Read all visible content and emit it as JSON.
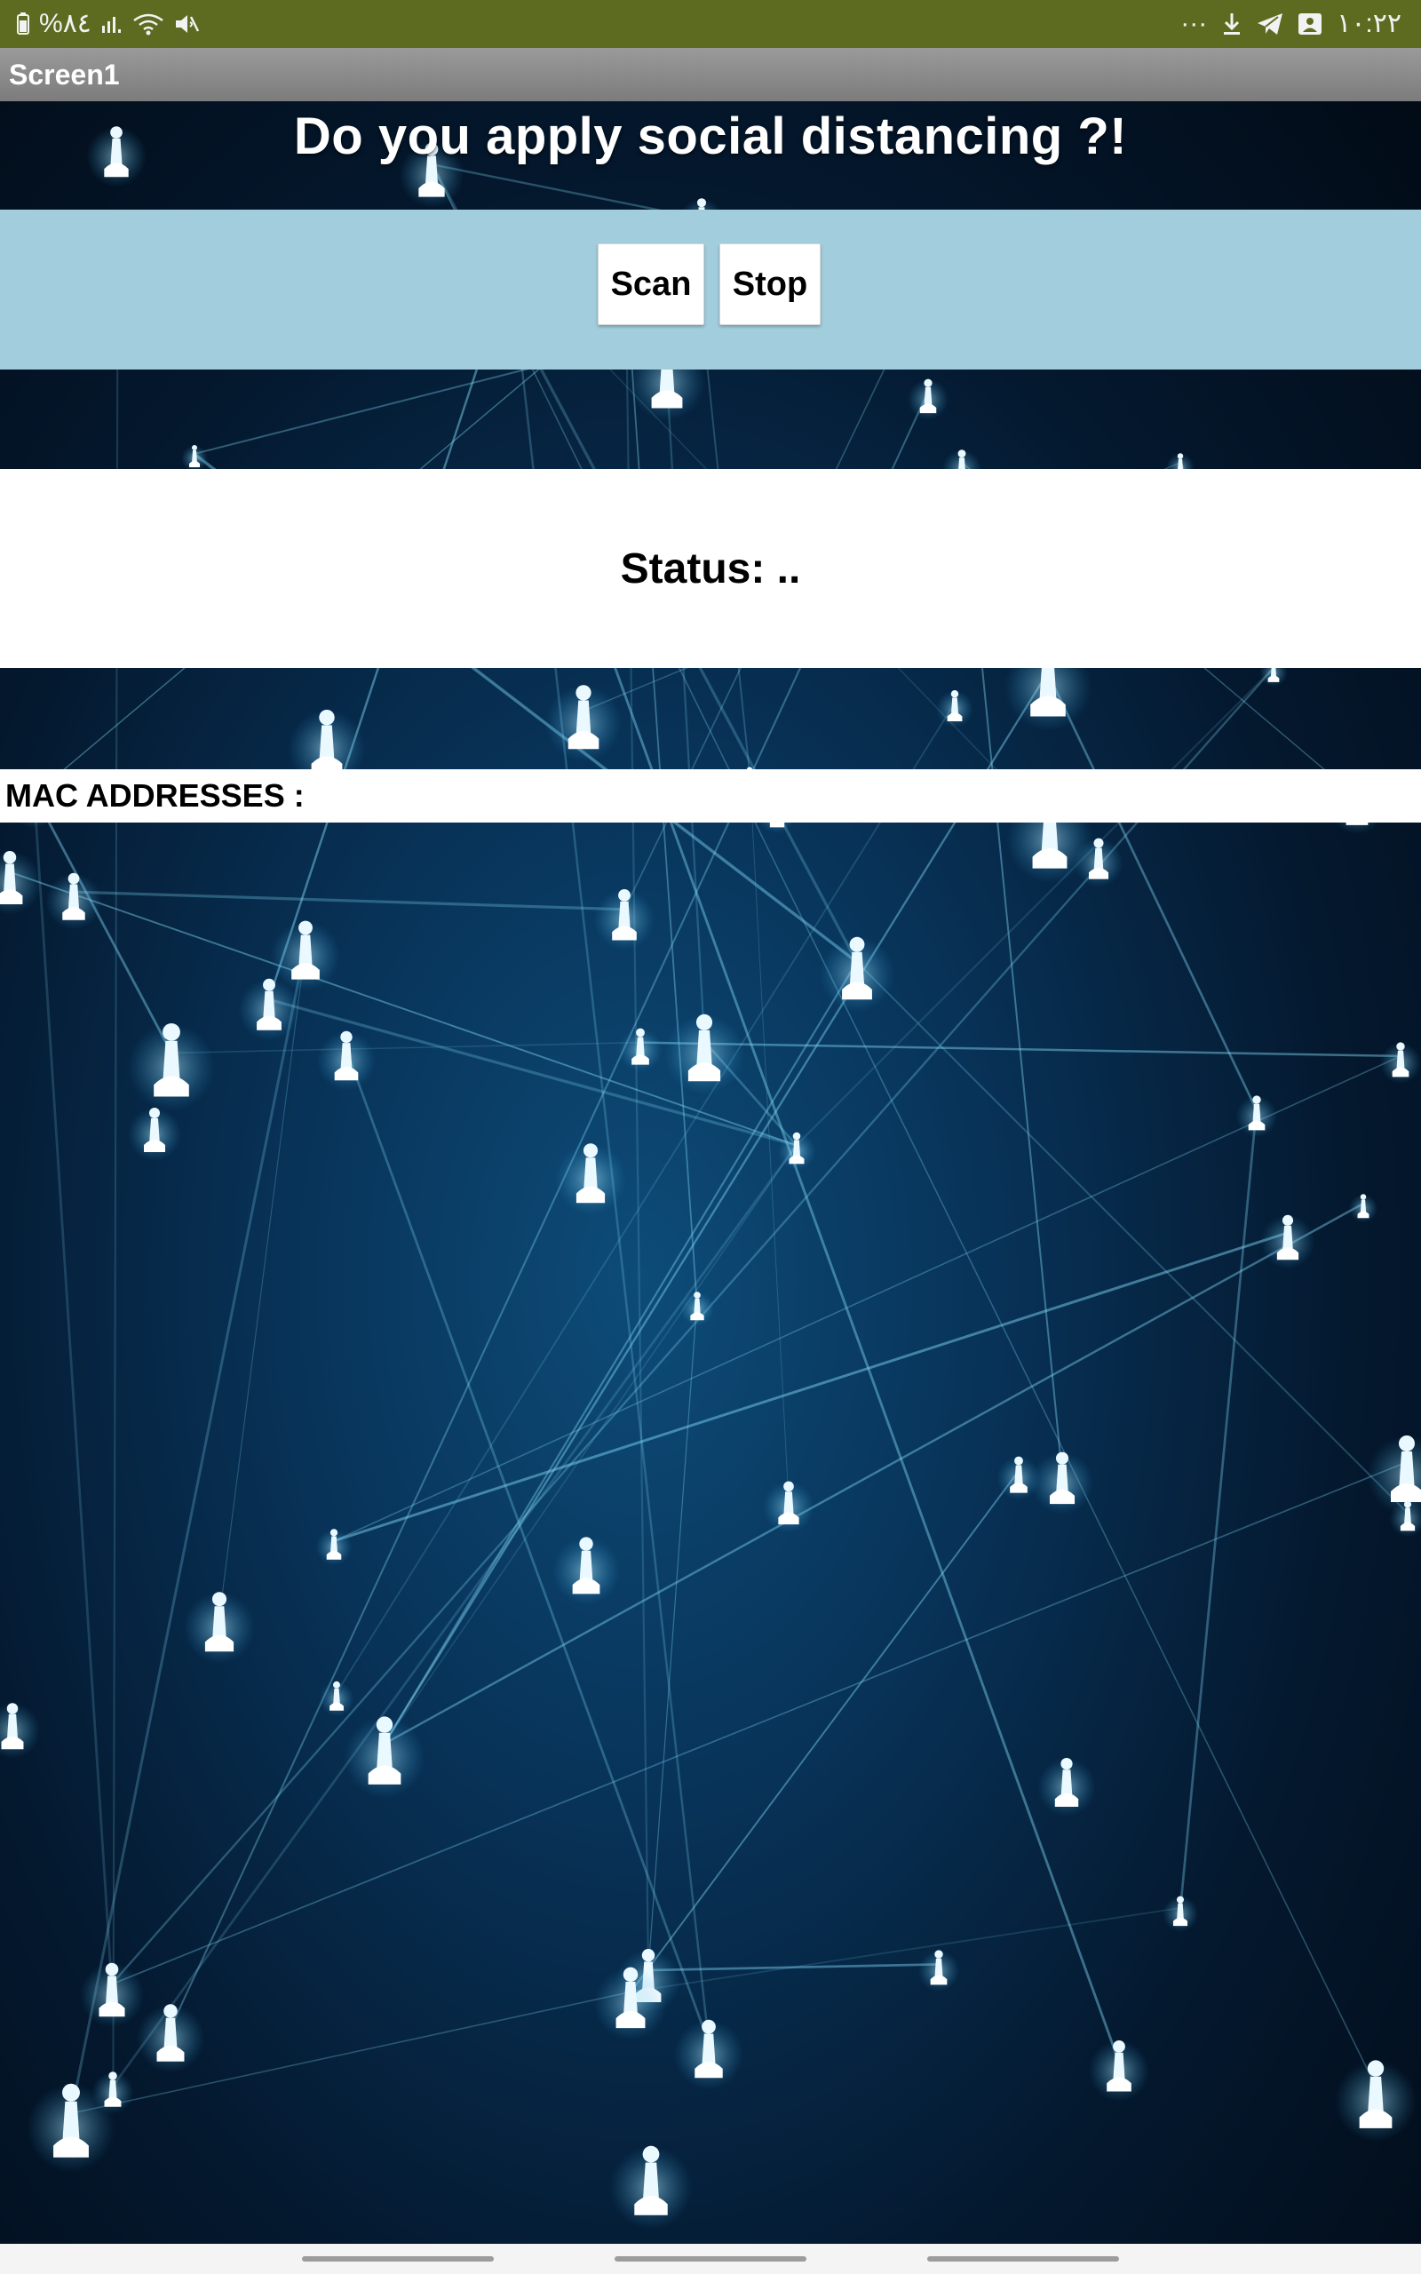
{
  "status_bar": {
    "left_text": "%٨٤",
    "time": "١٠:٢٢",
    "more": "···"
  },
  "app": {
    "screen_title": "Screen1"
  },
  "main": {
    "headline": "Do you apply social distancing ?!",
    "scan_label": "Scan",
    "stop_label": "Stop",
    "status_text": "Status: ..",
    "mac_label": "MAC ADDRESSES :"
  },
  "colors": {
    "status_bar": "#5d6b21",
    "title_bar": "#8a8a8a",
    "button_bar": "#a2cddd",
    "background": "#04182e"
  },
  "icons": [
    "battery-icon",
    "signal-icon",
    "wifi-icon",
    "mute-icon",
    "download-icon",
    "telegram-icon",
    "gallery-icon"
  ]
}
